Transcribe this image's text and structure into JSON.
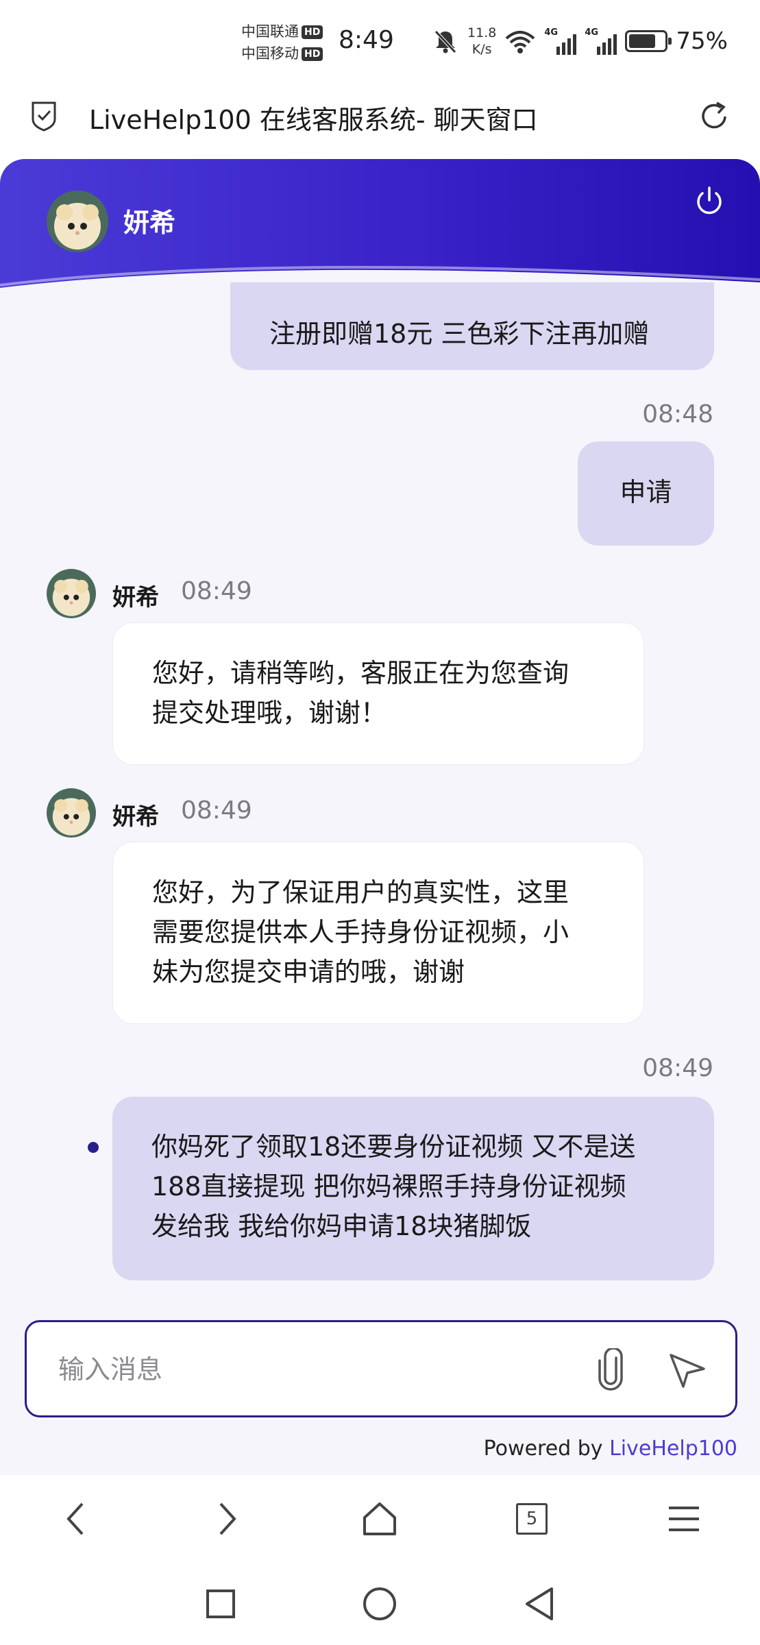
{
  "status_bar": {
    "carrier_1": "中国联通",
    "carrier_2": "中国移动",
    "hd_badge": "HD",
    "time": "8:49",
    "net_speed_value": "11.8",
    "net_speed_unit": "K/s",
    "signal_type": "4G",
    "battery_percent": "75%",
    "battery_level": 0.75
  },
  "browser": {
    "page_title": "LiveHelp100 在线客服系统- 聊天窗口",
    "tab_count": "5"
  },
  "chat": {
    "agent_name": "妍希",
    "messages": [
      {
        "direction": "out",
        "text_lines": [
          "注册即赠18元 三色彩下注再加赠"
        ]
      },
      {
        "direction": "out",
        "time": "08:48",
        "text_lines": [
          "申请"
        ]
      },
      {
        "direction": "in",
        "sender": "妍希",
        "time": "08:49",
        "text_lines": [
          "您好，请稍等哟，客服正在为您查询",
          "提交处理哦，谢谢！"
        ]
      },
      {
        "direction": "in",
        "sender": "妍希",
        "time": "08:49",
        "text_lines": [
          "您好，为了保证用户的真实性，这里",
          "需要您提供本人手持身份证视频，小",
          "妹为您提交申请的哦，谢谢"
        ]
      },
      {
        "direction": "out",
        "time": "08:49",
        "text_lines": [
          "你妈死了领取18还要身份证视频 又不是送",
          "188直接提现 把你妈裸照手持身份证视频",
          "发给我 我给你妈申请18块猪脚饭"
        ]
      }
    ]
  },
  "composer": {
    "placeholder": "输入消息",
    "attach_icon": "paperclip-icon",
    "send_icon": "send-icon"
  },
  "footer": {
    "powered_prefix": "Powered by ",
    "powered_brand": "LiveHelp100"
  },
  "colors": {
    "header_gradient_start": "#4b3bd6",
    "header_gradient_end": "#2410b0",
    "outgoing_bubble": "#d9d7f1",
    "incoming_bubble": "#ffffff",
    "chat_background": "#f6f5fb",
    "input_border": "#2a1e86",
    "brand_link": "#4b3bd6"
  }
}
